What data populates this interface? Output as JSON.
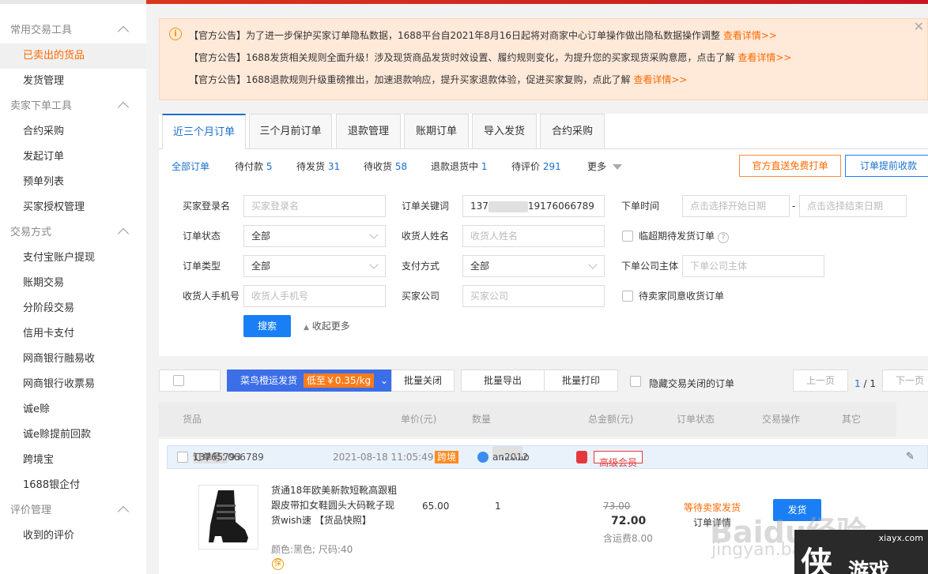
{
  "sidebar": {
    "groups": [
      {
        "title": "常用交易工具",
        "items": [
          "已卖出的货品",
          "发货管理"
        ]
      },
      {
        "title": "卖家下单工具",
        "items": [
          "合约采购",
          "发起订单",
          "预单列表",
          "买家授权管理"
        ]
      },
      {
        "title": "交易方式",
        "items": [
          "支付宝账户提现",
          "账期交易",
          "分阶段交易",
          "信用卡支付",
          "网商银行融易收",
          "网商银行收票易",
          "诚e赊",
          "诚e赊提前回款",
          "跨境宝",
          "1688银企付"
        ]
      },
      {
        "title": "评价管理",
        "items": [
          "收到的评价"
        ]
      }
    ]
  },
  "notices": [
    {
      "text": "【官方公告】为了进一步保护买家订单隐私数据，1688平台自2021年8月16日起将对商家中心订单操作做出隐私数据操作调整",
      "link": "查看详情>>"
    },
    {
      "text": "【官方公告】1688发货相关规则全面升级！涉及现货商品发货时效设置、履约规则变化，为提升您的买家现货采购意愿，点击了解",
      "link": "查看详情>>"
    },
    {
      "text": "【官方公告】1688退款规则升级重磅推出，加速退款响应，提升买家退款体验，促进买家复购，点此了解",
      "link": "查看详情>>"
    }
  ],
  "tabs": [
    "近三个月订单",
    "三个月前订单",
    "退款管理",
    "账期订单",
    "导入发货",
    "合约采购"
  ],
  "filters": {
    "all": "全部订单",
    "items": [
      {
        "label": "待付款",
        "count": "5"
      },
      {
        "label": "待发货",
        "count": "31"
      },
      {
        "label": "待收货",
        "count": "58"
      },
      {
        "label": "退款退货中",
        "count": "1"
      },
      {
        "label": "待评价",
        "count": "291"
      }
    ],
    "more": "更多"
  },
  "actions": {
    "print_free": "官方直送免费打单",
    "advance": "订单提前收款"
  },
  "form": {
    "buyer_login_label": "买家登录名",
    "buyer_login_ph": "买家登录名",
    "keyword_label": "订单关键词",
    "keyword_prefix": "137",
    "keyword_suffix": "19176066789",
    "time_label": "下单时间",
    "start_ph": "点击选择开始日期",
    "dash": "-",
    "end_ph": "点击选择结束日期",
    "status_label": "订单状态",
    "status_value": "全部",
    "receiver_label": "收货人姓名",
    "receiver_ph": "收货人姓名",
    "expire_label": "临超期待发货订单",
    "type_label": "订单类型",
    "type_value": "全部",
    "pay_label": "支付方式",
    "pay_value": "全部",
    "company_label": "下单公司主体",
    "company_ph": "下单公司主体",
    "phone_label": "收货人手机号",
    "phone_ph": "收货人手机号",
    "buyer_company_label": "买家公司",
    "buyer_company_ph": "买家公司",
    "wait_confirm_label": "待卖家同意收货订单",
    "search": "搜索",
    "collapse": "收起更多"
  },
  "toolbar": {
    "cainiao": "菜鸟橙运发货",
    "price_tag": "低至￥0.35/kg",
    "batch_close": "批量关闭",
    "batch_export": "批量导出",
    "batch_print": "批量打印",
    "hide_closed": "隐藏交易关闭的订单",
    "prev": "上一页",
    "page_current": "1",
    "page_total": "/ 1",
    "next": "下一页"
  },
  "columns": [
    "货品",
    "单价(元)",
    "数量",
    "总金额(元)",
    "订单状态",
    "交易操作",
    "其它"
  ],
  "order": {
    "id_label": "订单号：",
    "id_prefix": "13765793",
    "id_suffix": "066789",
    "time": "2021-08-18 11:05:49",
    "cross_tag": "跨境",
    "buyer_prefix": "ainixiao",
    "buyer_suffix": "an2012",
    "vip": "高级会员",
    "title": "货通18年欧美新款短靴高跟粗跟皮带扣女鞋圆头大码靴子现货wish速",
    "snapshot": "【货品快照】",
    "spec": "颜色:黑色;  尺码:40",
    "unit_price": "65.00",
    "qty": "1",
    "orig_total": "73.00",
    "total": "72.00",
    "shipping": "含运费8.00",
    "status": "等待卖家发货",
    "detail": "订单详情",
    "ship_btn": "发货"
  },
  "watermark": {
    "baidu": "Baidu经验",
    "jingyan": "jingyan.baidu.com",
    "site": "xiayx.com",
    "logo_text": "游戏"
  },
  "colors": {
    "accent": "#ff6a00",
    "blue": "#1a7ff5",
    "red": "#e4393c"
  }
}
